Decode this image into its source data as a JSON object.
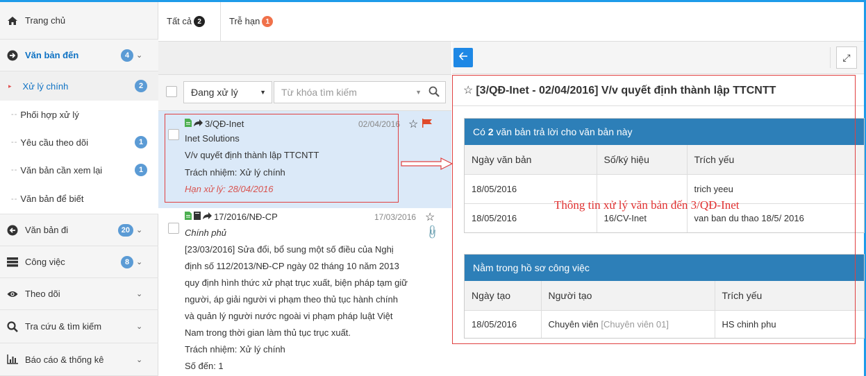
{
  "sidebar": {
    "items": [
      {
        "label": "Trang chủ",
        "icon": "home-icon"
      },
      {
        "label": "Văn bản đến",
        "badge": "4",
        "icon": "arrow-circle-right-icon"
      },
      {
        "label": "Văn bản đi",
        "badge": "20",
        "icon": "arrow-circle-left-icon"
      },
      {
        "label": "Công việc",
        "badge": "8",
        "icon": "tasks-icon"
      },
      {
        "label": "Theo dõi",
        "icon": "eye-icon"
      },
      {
        "label": "Tra cứu & tìm kiếm",
        "icon": "search-icon"
      },
      {
        "label": "Báo cáo & thống kê",
        "icon": "bar-chart-icon"
      }
    ],
    "subitems": [
      {
        "label": "Xử lý chính",
        "badge": "2"
      },
      {
        "label": "Phối hợp xử lý"
      },
      {
        "label": "Yêu cầu theo dõi",
        "badge": "1"
      },
      {
        "label": "Văn bản cần xem lại",
        "badge": "1"
      },
      {
        "label": "Văn bản để biết"
      }
    ]
  },
  "tabs": [
    {
      "label": "Tất cả",
      "count": "2"
    },
    {
      "label": "Trễ hạn",
      "count": "1"
    }
  ],
  "filter": {
    "status": "Đang xử lý",
    "search_placeholder": "Từ khóa tìm kiếm"
  },
  "documents": [
    {
      "code": "3/QĐ-Inet",
      "date": "02/04/2016",
      "org": "Inet Solutions",
      "summary": "V/v quyết định thành lập TTCNTT",
      "responsibility": "Trách nhiệm: Xử lý chính",
      "deadline": "Hạn xử lý: 28/04/2016"
    },
    {
      "code": "17/2016/NĐ-CP",
      "date": "17/03/2016",
      "org": "Chính phủ",
      "summary_lines": [
        "[23/03/2016] Sửa đổi, bổ sung một số điều của Nghị",
        "định số 112/2013/NĐ-CP ngày 02 tháng 10 năm 2013",
        "quy định hình thức xử phạt trục xuất, biện pháp tạm giữ",
        "người, áp giải người vi phạm theo thủ tục hành chính",
        "và quản lý người nước ngoài vi phạm pháp luật Việt",
        "Nam trong thời gian làm thủ tục trục xuất."
      ],
      "responsibility": "Trách nhiệm: Xử lý chính",
      "incoming_no": "Số đến: 1"
    }
  ],
  "detail": {
    "title": "[3/QĐ-Inet - 02/04/2016] V/v quyết định thành lập TTCNTT",
    "replies": {
      "header_prefix": "Có",
      "header_count": "2",
      "header_suffix": "văn bản trả lời cho văn bản này",
      "columns": [
        "Ngày văn bản",
        "Số/ký hiệu",
        "Trích yếu"
      ],
      "rows": [
        [
          "18/05/2016",
          "",
          "trich yeeu"
        ],
        [
          "18/05/2016",
          "16/CV-Inet",
          "van ban du thao 18/5/ 2016"
        ]
      ]
    },
    "folder": {
      "header": "Nằm trong hồ sơ công việc",
      "columns": [
        "Ngày tạo",
        "Người tạo",
        "Trích yếu"
      ],
      "rows": [
        {
          "date": "18/05/2016",
          "creator": "Chuyên viên",
          "creator_note": "[Chuyên viên 01]",
          "summary": "HS chinh phu"
        }
      ]
    }
  },
  "annotation": "Thông tin xử lý văn bản đến 3/QĐ-Inet",
  "colors": {
    "accent": "#1e9be9",
    "badge": "#5b9bd5",
    "panel_header": "#2d7fb8",
    "highlight": "#e04040",
    "selected_row": "#dbe9f8",
    "link": "#1a73c4"
  }
}
